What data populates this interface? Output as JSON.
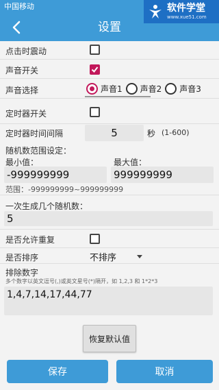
{
  "status_bar": {
    "carrier": "中国移动"
  },
  "watermark": {
    "title": "软件学堂",
    "url": "www.xue51.com"
  },
  "header": {
    "title": "设置"
  },
  "settings": {
    "click_vibrate": {
      "label": "点击时震动",
      "checked": false
    },
    "sound_switch": {
      "label": "声音开关",
      "checked": true
    },
    "sound_select": {
      "label": "声音选择",
      "options": [
        "声音1",
        "声音2",
        "声音3"
      ],
      "selected": "声音1"
    },
    "timer_switch": {
      "label": "定时器开关",
      "checked": false
    },
    "timer_interval": {
      "label": "定时器时间间隔",
      "value": "5",
      "unit": "秒",
      "range": "(1-600)"
    },
    "random_range": {
      "title": "随机数范围设定：",
      "min_label": "最小值：",
      "min_value": "-999999999",
      "max_label": "最大值：",
      "max_value": "999999999",
      "range_text": "范围：-999999999~999999999"
    },
    "count": {
      "label": "一次生成几个随机数：",
      "value": "5"
    },
    "allow_repeat": {
      "label": "是否允许重复",
      "checked": false
    },
    "sort": {
      "label": "是否排序",
      "value": "不排序"
    },
    "exclude": {
      "label": "排除数字",
      "hint": "多个数字以英文逗号(,)或英文星号(*)隔开，如 1,2,3 和 1*2*3",
      "value": "1,4,7,14,17,44,77"
    }
  },
  "buttons": {
    "restore": "恢复默认值",
    "save": "保存",
    "cancel": "取消"
  },
  "colors": {
    "primary": "#3e9bd7",
    "accent": "#c2185b"
  }
}
